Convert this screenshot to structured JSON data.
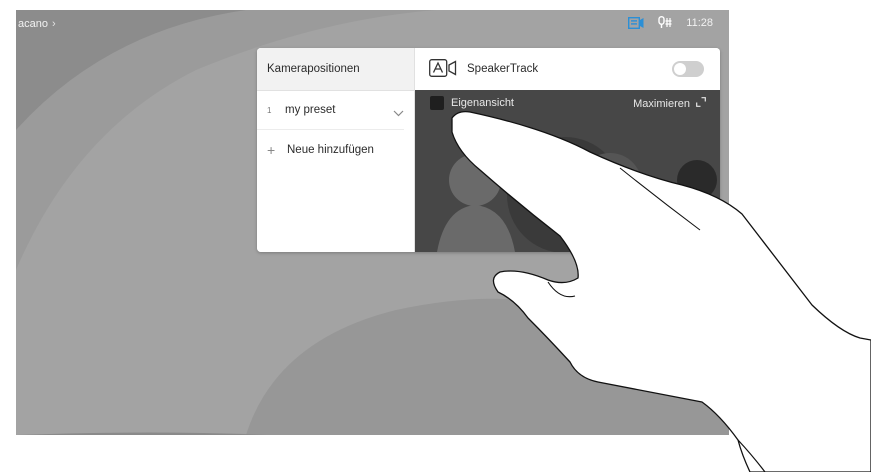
{
  "topbar": {
    "breadcrumb": "acano",
    "time": "11:28"
  },
  "panel": {
    "presets_title": "Kamerapositionen",
    "presets": [
      {
        "number": "1",
        "name": "my preset"
      }
    ],
    "add_label": "Neue hinzufügen",
    "speakertrack_label": "SpeakerTrack",
    "speakertrack_on": false,
    "selfview_label": "Eigenansicht",
    "maximize_label": "Maximieren"
  },
  "icons": {
    "breadcrumb": "chevron-right-icon",
    "share": "share-screen-icon",
    "mic": "mic-status-icon",
    "speakertrack": "speakertrack-camera-icon",
    "preset_menu": "chevron-down-icon",
    "add": "plus-icon",
    "maximize": "expand-icon",
    "camera_up": "chevron-up-icon"
  },
  "colors": {
    "screen_bg": "#8e8e8e",
    "accent": "#2b8fd6"
  }
}
